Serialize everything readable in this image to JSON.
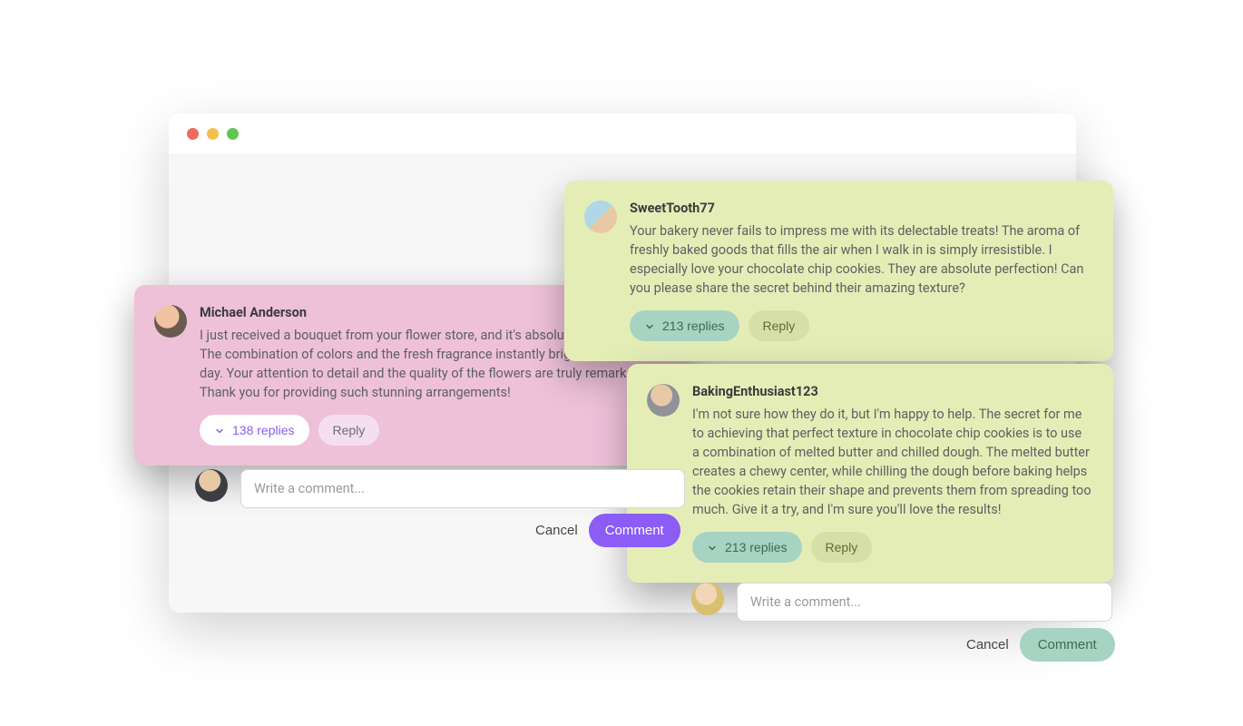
{
  "cards": {
    "pink": {
      "author": "Michael Anderson",
      "body": "I just received a bouquet from your flower store, and it's absolutely stunning! The combination of colors and the fresh fragrance instantly brightened up my day. Your attention to detail and the quality of the flowers are truly remarkable. Thank you for providing such stunning arrangements!",
      "replies_label": "138 replies",
      "reply_label": "Reply"
    },
    "lime1": {
      "author": "SweetTooth77",
      "body": "Your bakery never fails to impress me with its delectable treats! The aroma of freshly baked goods that fills the air when I walk in is simply irresistible. I especially love your chocolate chip cookies. They are absolute perfection! Can you please share the secret behind their amazing texture?",
      "replies_label": "213 replies",
      "reply_label": "Reply"
    },
    "lime2": {
      "author": "BakingEnthusiast123",
      "body": "I'm not sure how they do it, but I'm happy to help. The secret for me to achieving that perfect texture in chocolate chip cookies is to use a combination of melted butter and chilled dough. The melted butter creates a chewy center, while chilling the dough before baking helps the cookies retain their shape and prevents them from spreading too much. Give it a try, and I'm sure you'll love the results!",
      "replies_label": "213 replies",
      "reply_label": "Reply"
    }
  },
  "compose": {
    "placeholder": "Write a comment...",
    "cancel": "Cancel",
    "comment": "Comment"
  }
}
